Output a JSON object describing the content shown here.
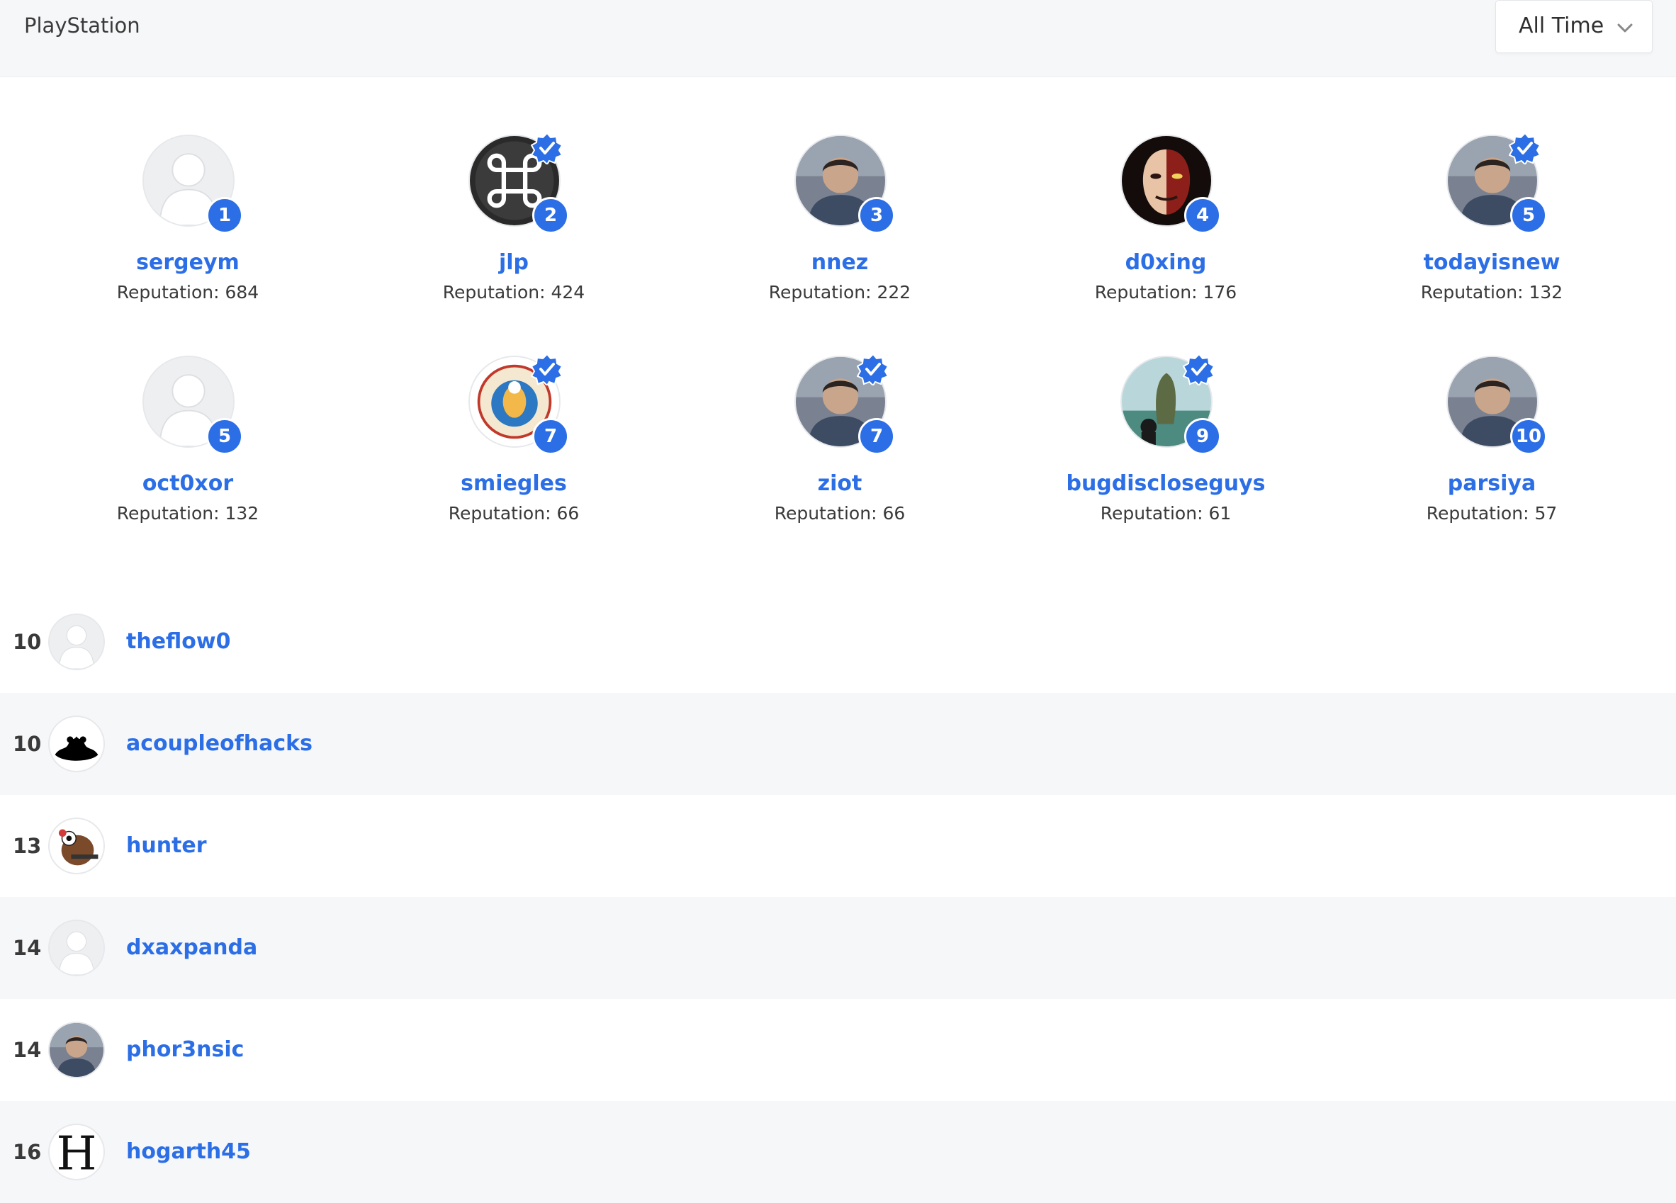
{
  "header": {
    "team_name": "PlayStation",
    "time_filter": "All Time"
  },
  "rep_prefix": "Reputation:",
  "top_hackers": [
    {
      "rank": "1",
      "username": "sergeym",
      "reputation": "Reputation: 684",
      "verified": false,
      "avatar": "default-avatar"
    },
    {
      "rank": "2",
      "username": "jlp",
      "reputation": "Reputation: 424",
      "verified": true,
      "avatar": "command-key-avatar"
    },
    {
      "rank": "3",
      "username": "nnez",
      "reputation": "Reputation: 222",
      "verified": false,
      "avatar": "photo-avatar"
    },
    {
      "rank": "4",
      "username": "d0xing",
      "reputation": "Reputation: 176",
      "verified": false,
      "avatar": "mask-avatar"
    },
    {
      "rank": "5",
      "username": "todayisnew",
      "reputation": "Reputation: 132",
      "verified": true,
      "avatar": "photo-avatar"
    },
    {
      "rank": "5",
      "username": "oct0xor",
      "reputation": "Reputation: 132",
      "verified": false,
      "avatar": "default-avatar"
    },
    {
      "rank": "7",
      "username": "smiegles",
      "reputation": "Reputation: 66",
      "verified": true,
      "avatar": "los-pollos-avatar"
    },
    {
      "rank": "7",
      "username": "ziot",
      "reputation": "Reputation: 66",
      "verified": true,
      "avatar": "photo-avatar"
    },
    {
      "rank": "9",
      "username": "bugdiscloseguys",
      "reputation": "Reputation: 61",
      "verified": true,
      "avatar": "island-avatar"
    },
    {
      "rank": "10",
      "username": "parsiya",
      "reputation": "Reputation: 57",
      "verified": false,
      "avatar": "photo-avatar"
    }
  ],
  "list": [
    {
      "rank": "10",
      "username": "theflow0",
      "avatar": "default-avatar"
    },
    {
      "rank": "10",
      "username": "acoupleofhacks",
      "avatar": "silhouette-avatar"
    },
    {
      "rank": "13",
      "username": "hunter",
      "avatar": "cartoon-avatar"
    },
    {
      "rank": "14",
      "username": "dxaxpanda",
      "avatar": "default-avatar"
    },
    {
      "rank": "14",
      "username": "phor3nsic",
      "avatar": "photo-avatar"
    },
    {
      "rank": "16",
      "username": "hogarth45",
      "avatar": "letter-h-avatar"
    }
  ],
  "colors": {
    "accent": "#2b6ee6",
    "header_bg": "#f6f7f9",
    "alt_row_bg": "#f6f7f9"
  }
}
